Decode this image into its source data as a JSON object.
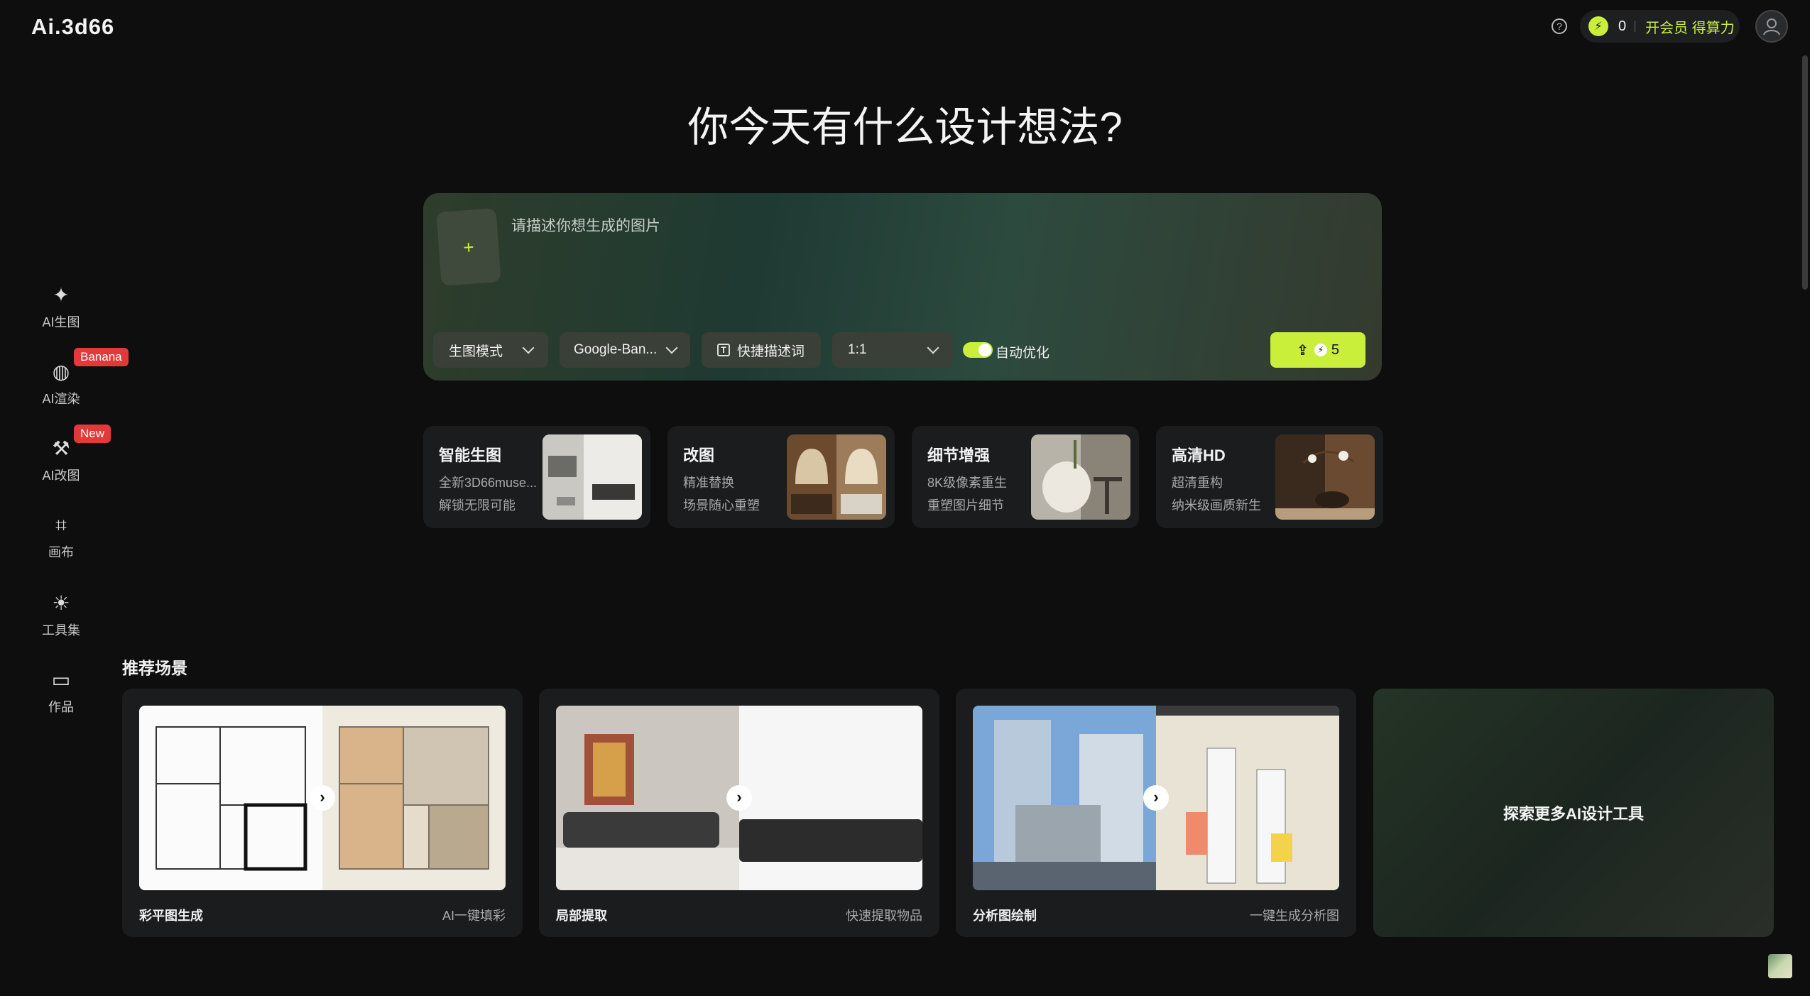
{
  "header": {
    "logo": "Ai.3d66",
    "help_icon": "question-circle-icon",
    "credits_icon": "lightning-icon",
    "credits": "0",
    "member_cta": "开会员 得算力",
    "avatar_icon": "user-avatar-icon"
  },
  "sidebar": {
    "items": [
      {
        "label": "AI生图",
        "icon": "sparkle-icon",
        "glyph": "✦",
        "badge": ""
      },
      {
        "label": "AI渲染",
        "icon": "render-icon",
        "glyph": "◍",
        "badge": "Banana"
      },
      {
        "label": "AI改图",
        "icon": "magic-wand-icon",
        "glyph": "⚒",
        "badge": "New"
      },
      {
        "label": "画布",
        "icon": "crop-canvas-icon",
        "glyph": "⌗",
        "badge": ""
      },
      {
        "label": "工具集",
        "icon": "lightbulb-icon",
        "glyph": "☀",
        "badge": ""
      },
      {
        "label": "作品",
        "icon": "folder-icon",
        "glyph": "▭",
        "badge": ""
      }
    ]
  },
  "hero": {
    "title": "你今天有什么设计想法?"
  },
  "prompt": {
    "upload_glyph": "+",
    "placeholder": "请描述你想生成的图片",
    "mode_label": "生图模式",
    "model_label": "Google-Ban...",
    "quick_label": "快捷描述词",
    "ratio_label": "1:1",
    "auto_optimize_label": "自动优化",
    "auto_optimize_on": true,
    "generate_cost": "5"
  },
  "features": [
    {
      "title": "智能生图",
      "line1": "全新3D66muse...",
      "line2": "解锁无限可能"
    },
    {
      "title": "改图",
      "line1": "精准替换",
      "line2": "场景随心重塑"
    },
    {
      "title": "细节增强",
      "line1": "8K级像素重生",
      "line2": "重塑图片细节"
    },
    {
      "title": "高清HD",
      "line1": "超清重构",
      "line2": "纳米级画质新生"
    }
  ],
  "recommended": {
    "title": "推荐场景",
    "scenes": [
      {
        "name": "彩平图生成",
        "desc": "AI一键填彩"
      },
      {
        "name": "局部提取",
        "desc": "快速提取物品"
      },
      {
        "name": "分析图绘制",
        "desc": "一键生成分析图"
      }
    ],
    "explore_label": "探索更多AI设计工具"
  },
  "colors": {
    "accent": "#c9ef3b",
    "background": "#0e0e0f",
    "card": "#1b1c1e",
    "badge": "#e23a3a"
  }
}
